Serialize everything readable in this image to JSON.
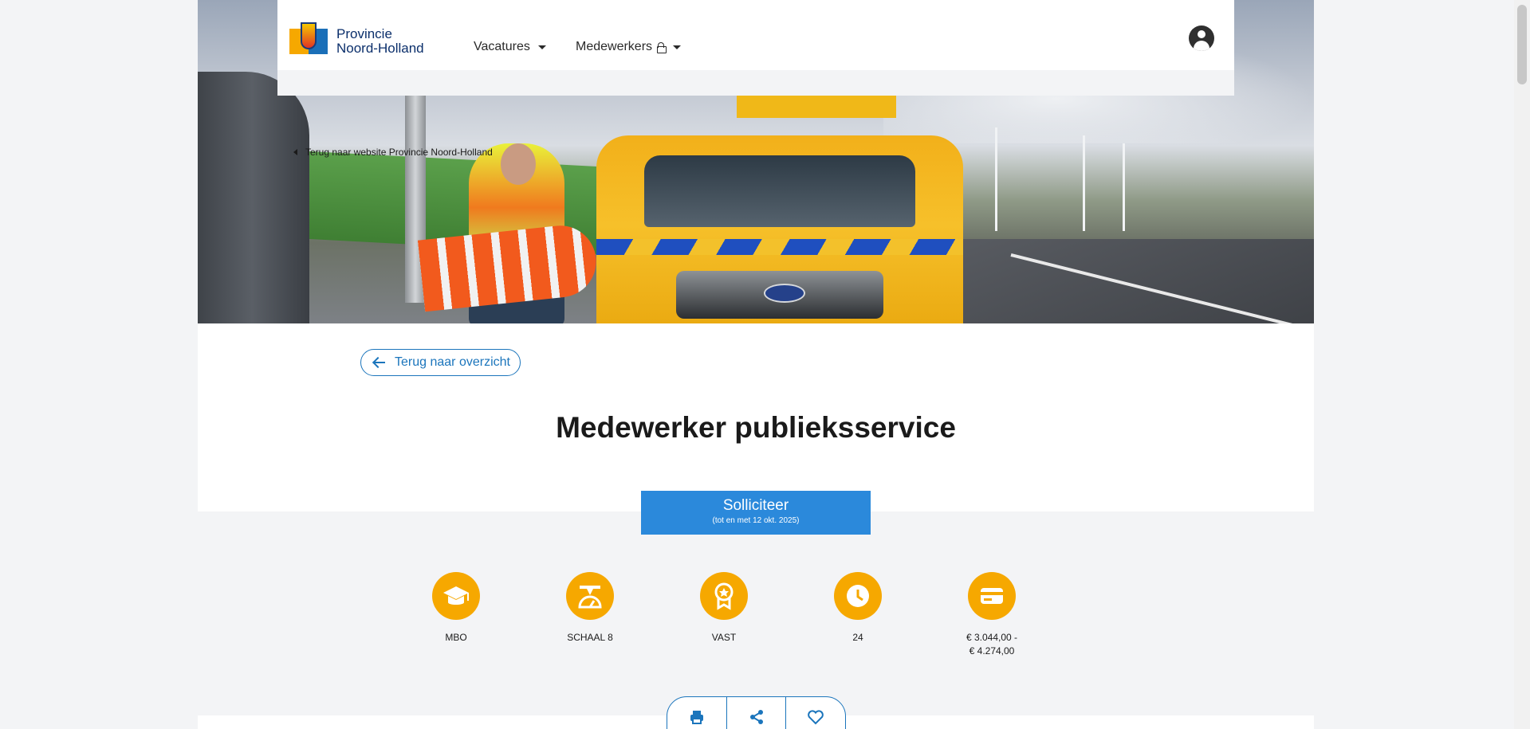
{
  "header": {
    "brand_line1": "Provincie",
    "brand_line2": "Noord-Holland",
    "nav": [
      {
        "label": "Vacatures"
      },
      {
        "label": "Medewerkers"
      }
    ],
    "back_site_label": "Terug naar website Provincie Noord-Holland"
  },
  "main": {
    "back_button_label": "Terug naar overzicht",
    "title": "Medewerker publieksservice",
    "apply": {
      "label": "Solliciteer",
      "sub": "(tot en met 12 okt. 2025)"
    }
  },
  "facts": [
    {
      "icon": "graduation-cap-icon",
      "label": "MBO"
    },
    {
      "icon": "scale-icon",
      "label": "SCHAAL 8"
    },
    {
      "icon": "award-ribbon-icon",
      "label": "VAST"
    },
    {
      "icon": "clock-icon",
      "label": "24"
    },
    {
      "icon": "wallet-icon",
      "label": "€ 3.044,00 -\n€ 4.274,00"
    }
  ],
  "actions": [
    {
      "icon": "print-icon"
    },
    {
      "icon": "share-icon"
    },
    {
      "icon": "heart-icon"
    }
  ],
  "colors": {
    "accent_blue": "#1b75bc",
    "apply_blue": "#2b89db",
    "fact_orange": "#f6a800"
  }
}
